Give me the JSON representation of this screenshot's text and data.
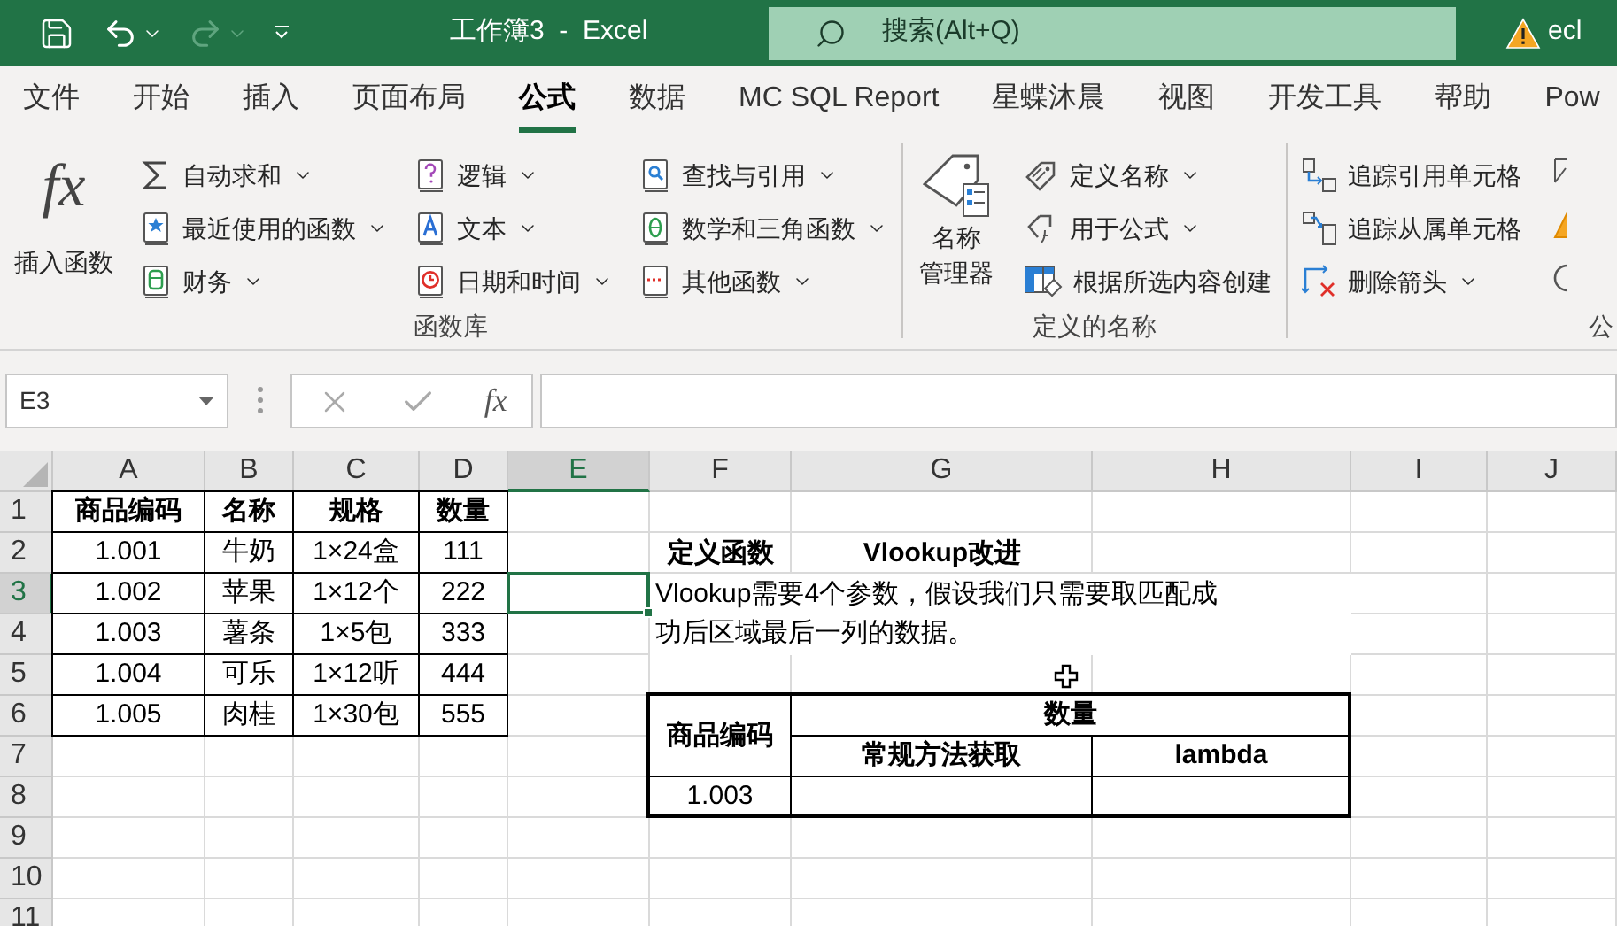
{
  "title_bar": {
    "title": "工作簿3  -  Excel",
    "search": {
      "placeholder": "搜索(Alt+Q)"
    },
    "account": "ecl"
  },
  "menu_tabs": [
    {
      "label": "文件",
      "selected": false
    },
    {
      "label": "开始",
      "selected": false
    },
    {
      "label": "插入",
      "selected": false
    },
    {
      "label": "页面布局",
      "selected": false
    },
    {
      "label": "公式",
      "selected": true
    },
    {
      "label": "数据",
      "selected": false
    },
    {
      "label": "MC SQL Report",
      "selected": false
    },
    {
      "label": "星蝶沐晨",
      "selected": false
    },
    {
      "label": "视图",
      "selected": false
    },
    {
      "label": "开发工具",
      "selected": false
    },
    {
      "label": "帮助",
      "selected": false
    },
    {
      "label": "Pow",
      "selected": false
    }
  ],
  "ribbon": {
    "groups": [
      {
        "label": "函数库",
        "large_buttons": [
          {
            "label_lines": [
              "插入函数"
            ],
            "icon_text": "fx"
          }
        ],
        "columns": [
          [
            {
              "label": "自动求和",
              "dropdown": true
            },
            {
              "label": "最近使用的函数",
              "dropdown": true
            },
            {
              "label": "财务",
              "dropdown": true
            }
          ],
          [
            {
              "label": "逻辑",
              "dropdown": true
            },
            {
              "label": "文本",
              "dropdown": true
            },
            {
              "label": "日期和时间",
              "dropdown": true
            }
          ],
          [
            {
              "label": "查找与引用",
              "dropdown": true
            },
            {
              "label": "数学和三角函数",
              "dropdown": true
            },
            {
              "label": "其他函数",
              "dropdown": true
            }
          ]
        ]
      },
      {
        "label": "定义的名称",
        "large_buttons": [
          {
            "label_lines": [
              "名称",
              "管理器"
            ]
          }
        ],
        "columns": [
          [
            {
              "label": "定义名称",
              "dropdown": true
            },
            {
              "label": "用于公式",
              "dropdown": true
            },
            {
              "label": "根据所选内容创建",
              "dropdown": false
            }
          ]
        ]
      },
      {
        "label": "公",
        "columns": [
          [
            {
              "label": "追踪引用单元格",
              "dropdown": false
            },
            {
              "label": "追踪从属单元格",
              "dropdown": false
            },
            {
              "label": "删除箭头",
              "dropdown": true
            }
          ]
        ]
      }
    ]
  },
  "formula_bar": {
    "name_box": "E3",
    "fx_button": "fx"
  },
  "sheet": {
    "columns": [
      {
        "label": "A",
        "selected": false
      },
      {
        "label": "B",
        "selected": false
      },
      {
        "label": "C",
        "selected": false
      },
      {
        "label": "D",
        "selected": false
      },
      {
        "label": "E",
        "selected": true
      },
      {
        "label": "F",
        "selected": false
      },
      {
        "label": "G",
        "selected": false
      },
      {
        "label": "H",
        "selected": false
      },
      {
        "label": "I",
        "selected": false
      },
      {
        "label": "J",
        "selected": false
      }
    ],
    "rows": [
      {
        "label": "1",
        "selected": false
      },
      {
        "label": "2",
        "selected": false
      },
      {
        "label": "3",
        "selected": true
      },
      {
        "label": "4",
        "selected": false
      },
      {
        "label": "5",
        "selected": false
      },
      {
        "label": "6",
        "selected": false
      },
      {
        "label": "7",
        "selected": false
      },
      {
        "label": "8",
        "selected": false
      },
      {
        "label": "9",
        "selected": false
      },
      {
        "label": "10",
        "selected": false
      },
      {
        "label": "11",
        "selected": false
      }
    ],
    "product_table": {
      "columns": [
        "商品编码",
        "名称",
        "规格",
        "数量"
      ],
      "rows": [
        [
          "1.001",
          "牛奶",
          "1×24盒",
          "111"
        ],
        [
          "1.002",
          "苹果",
          "1×12个",
          "222"
        ],
        [
          "1.003",
          "薯条",
          "1×5包",
          "333"
        ],
        [
          "1.004",
          "可乐",
          "1×12听",
          "444"
        ],
        [
          "1.005",
          "肉桂",
          "1×30包",
          "555"
        ]
      ]
    },
    "notes": {
      "title": "定义函数",
      "subtitle": "Vlookup改进",
      "description": "Vlookup需要4个参数，假设我们只需要取匹配成功后区域最后一列的数据。"
    },
    "lookup_table": {
      "key_header": "商品编码",
      "value_header": "数量",
      "sub_headers": [
        "常规方法获取",
        "lambda"
      ],
      "rows": [
        {
          "key": "1.003"
        }
      ]
    }
  }
}
